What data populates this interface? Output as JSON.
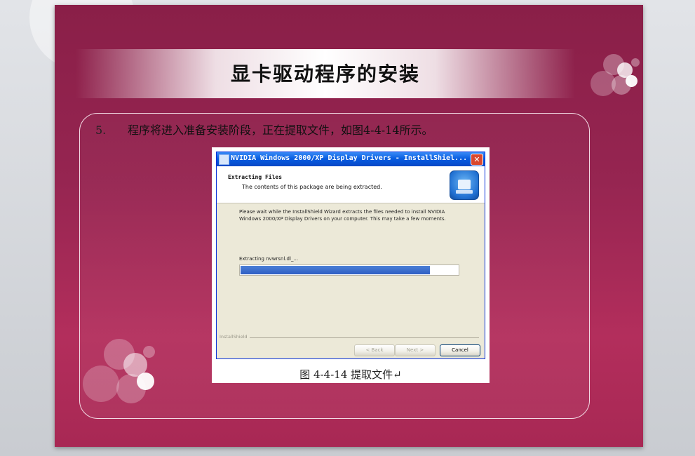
{
  "slide": {
    "title": "显卡驱动程序的安装",
    "step_number": "5.",
    "step_text": "程序将进入准备安装阶段，正在提取文件，如图4-4-14所示。",
    "caption": "图 4-4-14  提取文件↵"
  },
  "dialog": {
    "window_title": "NVIDIA Windows 2000/XP Display Drivers - InstallShiel...",
    "close_glyph": "✕",
    "header_title": "Extracting Files",
    "header_subtitle": "The contents of this package are being extracted.",
    "body_text": "Please wait while the InstallShield Wizard extracts the files needed to install NVIDIA Windows 2000/XP Display Drivers on your computer.  This may take a few moments.",
    "extracting_label": "Extracting nvwrsnl.dl_...",
    "progress_fraction": 0.87,
    "brand": "InstallShield",
    "buttons": {
      "back": "< Back",
      "next": "Next >",
      "cancel": "Cancel"
    }
  },
  "colors": {
    "slide_bg": "#962551",
    "titlebar_blue": "#0a5ee0",
    "progress_blue": "#2f5fc4",
    "dialog_face": "#ece9d8"
  }
}
